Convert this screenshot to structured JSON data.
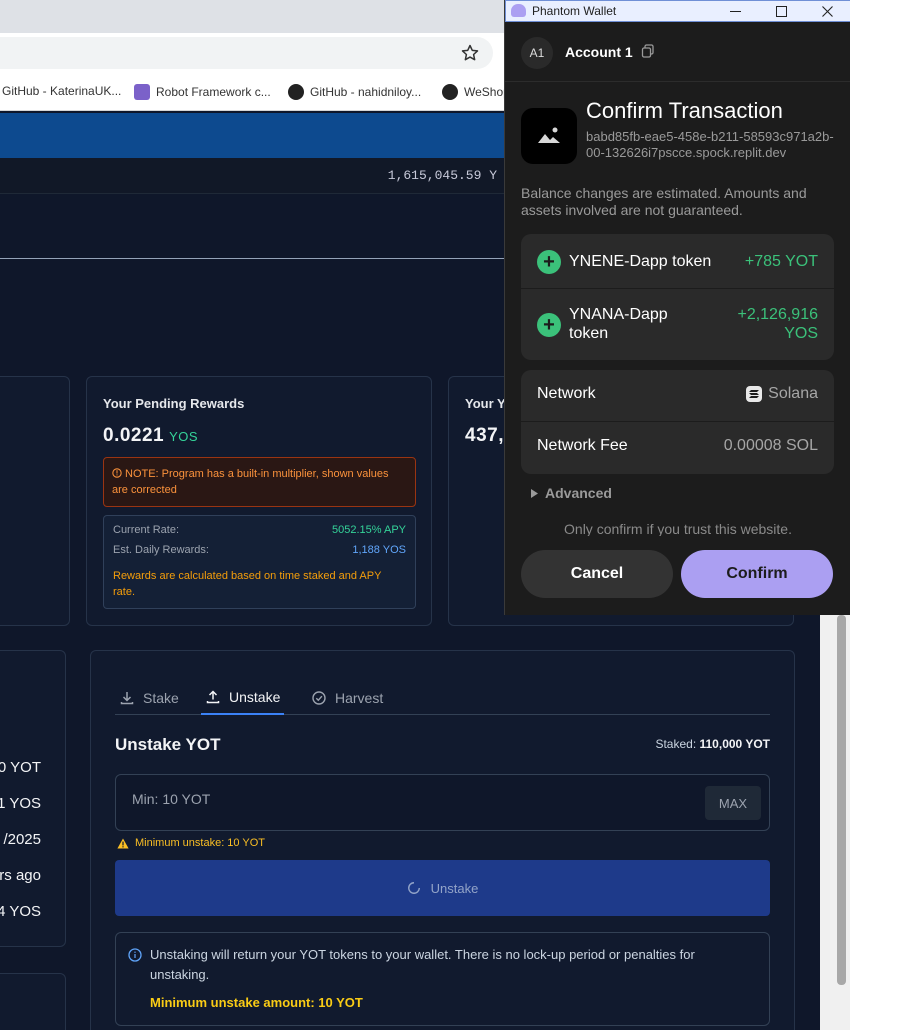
{
  "browser": {
    "bookmarks": [
      {
        "label": "GitHub - KaterinaUK...",
        "icon": "github-icon"
      },
      {
        "label": "Robot Framework c...",
        "icon": "robot-framework-icon"
      },
      {
        "label": "GitHub - nahidniloy...",
        "icon": "github-icon"
      },
      {
        "label": "WeShop",
        "icon": "github-icon"
      }
    ]
  },
  "page": {
    "ticker_value": "1,615,045.59 Y",
    "pending_rewards": {
      "title": "Your Pending Rewards",
      "value": "0.0221",
      "unit": "YOS",
      "note": "NOTE: Program has a built-in multiplier, shown values are corrected",
      "current_rate_label": "Current Rate:",
      "current_rate_value": "5052.15% APY",
      "daily_label": "Est. Daily Rewards:",
      "daily_value": "1,188 YOS",
      "rewards_note": "Rewards are calculated based on time staked and APY rate."
    },
    "partial_card": {
      "title": "Your Y",
      "value": "437,"
    },
    "left_values": [
      "0 YOT",
      "1 YOS",
      "/2025",
      "rs ago",
      "4 YOS"
    ],
    "tabs": [
      {
        "label": "Stake",
        "icon": "download-icon",
        "active": false
      },
      {
        "label": "Unstake",
        "icon": "upload-icon",
        "active": true
      },
      {
        "label": "Harvest",
        "icon": "check-circle-icon",
        "active": false
      }
    ],
    "unstake": {
      "title": "Unstake YOT",
      "staked_label": "Staked:",
      "staked_value": "110,000 YOT",
      "input_placeholder": "Min: 10 YOT",
      "max_label": "MAX",
      "min_warning": "Minimum unstake: 10 YOT",
      "button_label": "Unstake",
      "info_text": "Unstaking will return your YOT tokens to your wallet. There is no lock-up period or penalties for unstaking.",
      "info_strong": "Minimum unstake amount: 10 YOT"
    }
  },
  "phantom": {
    "window_title": "Phantom Wallet",
    "account_avatar": "A1",
    "account_name": "Account 1",
    "heading": "Confirm Transaction",
    "origin": "babd85fb-eae5-458e-b211-58593c971a2b-00-132626i7pscce.spock.replit.dev",
    "disclaimer": "Balance changes are estimated. Amounts and assets involved are not guaranteed.",
    "changes": [
      {
        "label": "YNENE-Dapp token",
        "amount": "+785 YOT"
      },
      {
        "label": "YNANA-Dapp token",
        "amount": "+2,126,916 YOS"
      }
    ],
    "network_label": "Network",
    "network_value": "Solana",
    "fee_label": "Network Fee",
    "fee_value": "0.00008 SOL",
    "advanced_label": "Advanced",
    "trust_text": "Only confirm if you trust this website.",
    "cancel_label": "Cancel",
    "confirm_label": "Confirm",
    "colors": {
      "accent": "#ab9ff2",
      "gain": "#3bc17a"
    }
  }
}
